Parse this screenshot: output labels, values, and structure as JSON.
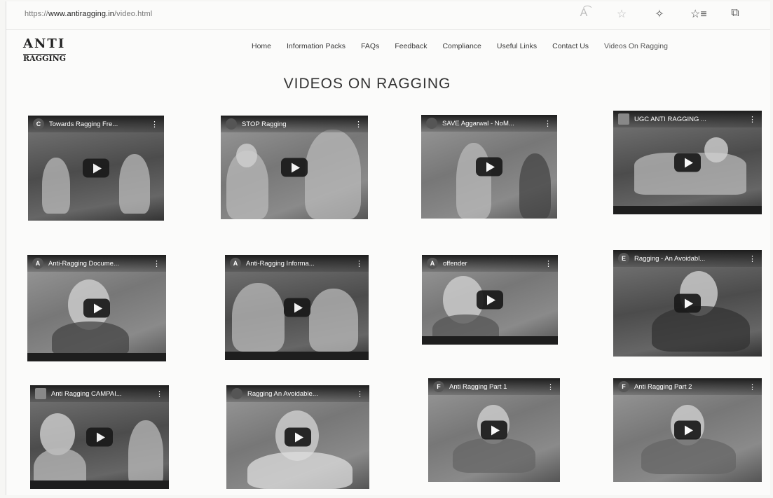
{
  "browser": {
    "url_prefix": "https://",
    "url_domain": "www.antiragging.in",
    "url_path": "/video.html",
    "icons": [
      "read-aloud-icon",
      "favorite-star-icon",
      "extensions-icon",
      "favorites-list-icon",
      "collections-icon"
    ]
  },
  "site": {
    "logo_top": "ANTI",
    "logo_bottom": "RAGGING"
  },
  "nav": [
    {
      "label": "Home"
    },
    {
      "label": "Information Packs"
    },
    {
      "label": "FAQs"
    },
    {
      "label": "Feedback"
    },
    {
      "label": "Compliance"
    },
    {
      "label": "Useful Links"
    },
    {
      "label": "Contact Us"
    },
    {
      "label": "Videos On Ragging"
    }
  ],
  "page_title": "VIDEOS ON RAGGING",
  "videos": [
    {
      "channel_initial": "C",
      "title": "Towards Ragging Fre..."
    },
    {
      "channel_initial": "",
      "title": "STOP Ragging"
    },
    {
      "channel_initial": "",
      "title": "SAVE Aggarwal - NoM..."
    },
    {
      "channel_initial": "",
      "title": "UGC ANTI RAGGING ..."
    },
    {
      "channel_initial": "A",
      "title": "Anti-Ragging Docume..."
    },
    {
      "channel_initial": "A",
      "title": "Anti-Ragging Informa..."
    },
    {
      "channel_initial": "A",
      "title": "offender"
    },
    {
      "channel_initial": "E",
      "title": "Ragging - An Avoidabl..."
    },
    {
      "channel_initial": "",
      "title": "Anti Ragging CAMPAI..."
    },
    {
      "channel_initial": "",
      "title": "Ragging An Avoidable..."
    },
    {
      "channel_initial": "F",
      "title": "Anti Ragging Part 1"
    },
    {
      "channel_initial": "F",
      "title": "Anti Ragging Part 2"
    }
  ]
}
